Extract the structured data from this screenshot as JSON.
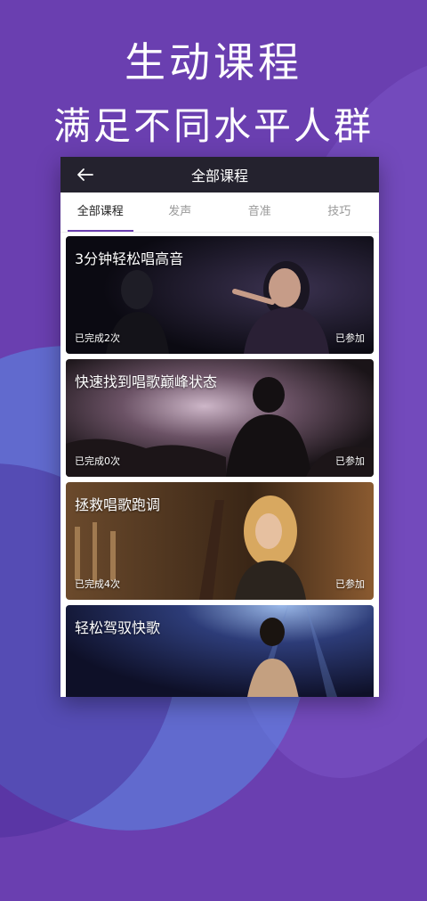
{
  "headline": {
    "line1": "生动课程",
    "line2": "满足不同水平人群"
  },
  "app": {
    "title": "全部课程",
    "back_icon": "back-arrow-icon",
    "tabs": [
      {
        "label": "全部课程",
        "active": true
      },
      {
        "label": "发声",
        "active": false
      },
      {
        "label": "音准",
        "active": false
      },
      {
        "label": "技巧",
        "active": false
      }
    ],
    "courses": [
      {
        "title": "3分钟轻松唱高音",
        "completed": "已完成2次",
        "status": "已参加"
      },
      {
        "title": "快速找到唱歌巅峰状态",
        "completed": "已完成0次",
        "status": "已参加"
      },
      {
        "title": "拯救唱歌跑调",
        "completed": "已完成4次",
        "status": "已参加"
      },
      {
        "title": "轻松驾驭快歌",
        "completed": "",
        "status": ""
      }
    ]
  },
  "colors": {
    "background": "#6a3fb0",
    "appbar": "#24222e",
    "tab_indicator": "#6a3fb0"
  }
}
